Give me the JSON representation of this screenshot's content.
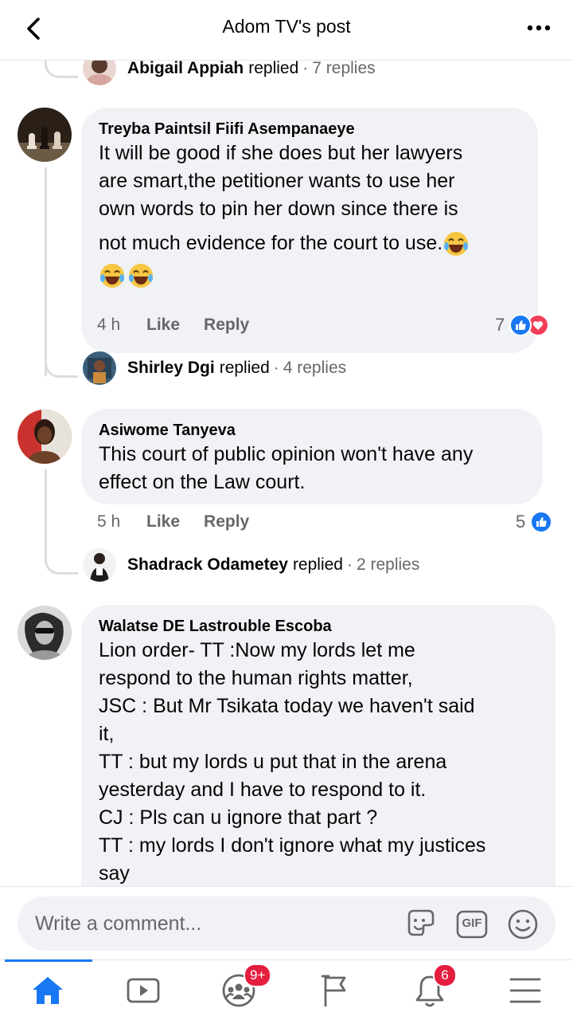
{
  "header": {
    "title": "Adom TV's post"
  },
  "replies": [
    {
      "name": "Abigail Appiah",
      "word": "replied",
      "count": "7 replies"
    },
    {
      "name": "Shirley Dgi",
      "word": "replied",
      "count": "4 replies"
    },
    {
      "name": "Shadrack Odametey",
      "word": "replied",
      "count": "2 replies"
    }
  ],
  "comments": [
    {
      "author": "Treyba Paintsil Fiifi Asempanaeye",
      "lines": [
        "It will be good if she does but her lawyers",
        "are smart,the petitioner wants to use her",
        "own words to pin her down since there is",
        "not much evidence for the court to use."
      ],
      "time": "4 h",
      "like": "Like",
      "reply": "Reply",
      "reaction_count": "7",
      "reactions": [
        "like-icon",
        "love-icon"
      ]
    },
    {
      "author": "Asiwome Tanyeva",
      "lines": [
        "This court of public opinion won't have any",
        "effect on the Law court."
      ],
      "time": "5 h",
      "like": "Like",
      "reply": "Reply",
      "reaction_count": "5",
      "reactions": [
        "like-icon"
      ]
    },
    {
      "author": "Walatse DE Lastrouble Escoba",
      "lines": [
        "Lion order- TT :Now my lords let me",
        "respond to the human rights matter,",
        "JSC : But Mr Tsikata today we haven't said",
        "it,",
        "TT : but my lords u put that in the arena",
        "yesterday and I have to respond to it.",
        "CJ : Pls can u ignore that part ?",
        "TT : my lords I don't ignore what my justices",
        "say"
      ]
    }
  ],
  "composer": {
    "placeholder": "Write a comment...",
    "gif_label": "GIF"
  },
  "nav": {
    "groups_badge": "9+",
    "notifications_badge": "6"
  },
  "colors": {
    "accent": "#1877f2",
    "love": "#f33e58",
    "badge": "#e41e3f",
    "bubble": "#f0f2f5"
  }
}
